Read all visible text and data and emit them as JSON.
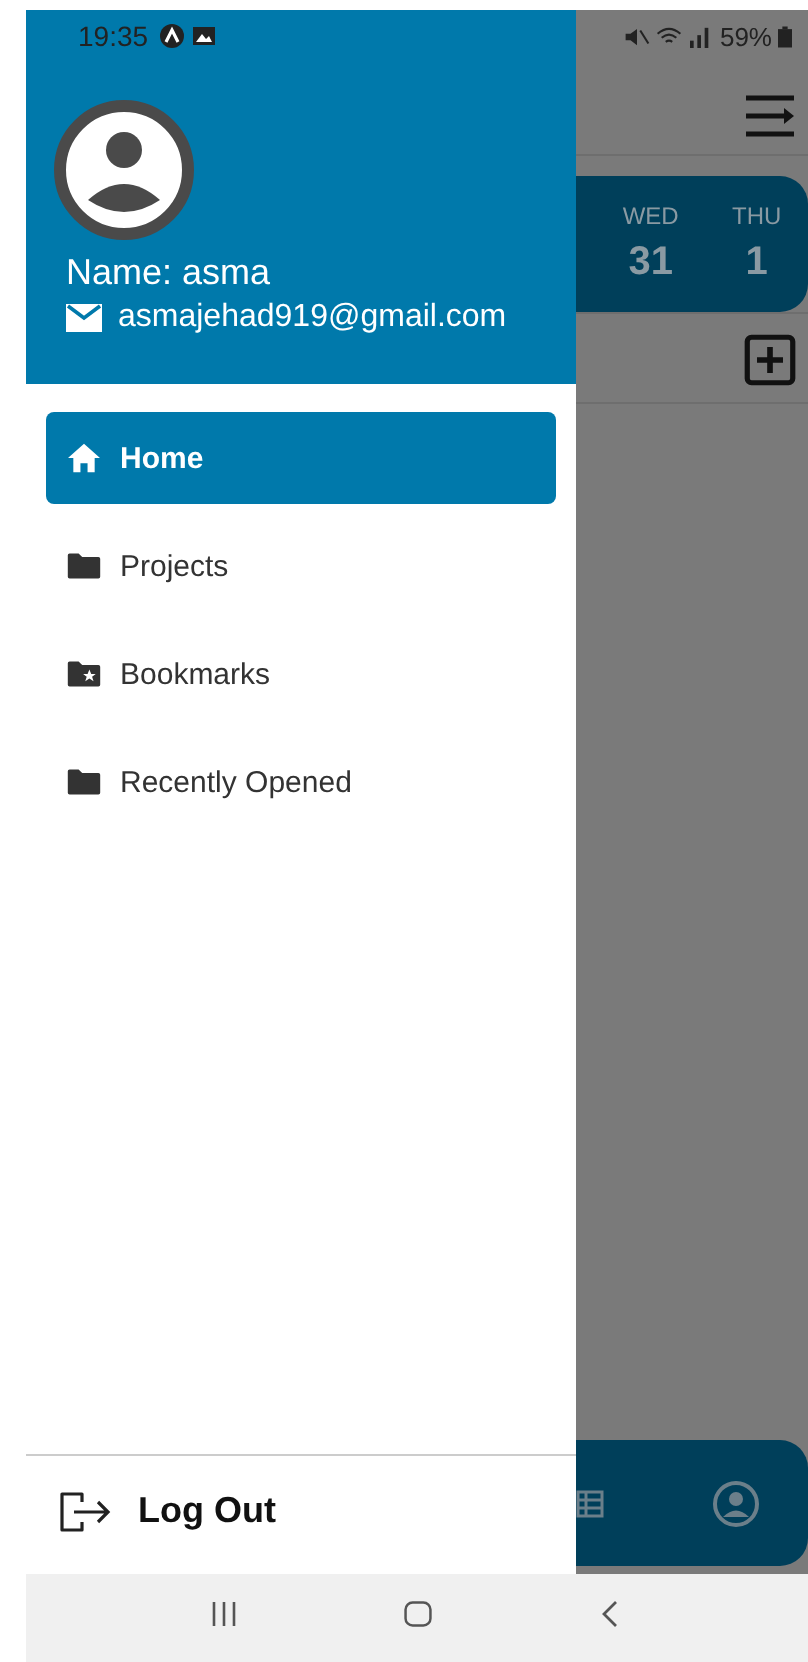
{
  "status_bar": {
    "time": "19:35",
    "battery": "59%"
  },
  "drawer": {
    "name": "Name: asma",
    "email": "asmajehad919@gmail.com",
    "items": [
      {
        "label": "Home",
        "kind": "home",
        "selected": true
      },
      {
        "label": "Projects",
        "kind": "folder",
        "selected": false
      },
      {
        "label": "Bookmarks",
        "kind": "bookmark",
        "selected": false
      },
      {
        "label": "Recently Opened",
        "kind": "folder",
        "selected": false
      }
    ],
    "logout": "Log Out"
  },
  "background": {
    "days": [
      {
        "day": "WED",
        "date": "31"
      },
      {
        "day": "THU",
        "date": "1"
      }
    ]
  }
}
